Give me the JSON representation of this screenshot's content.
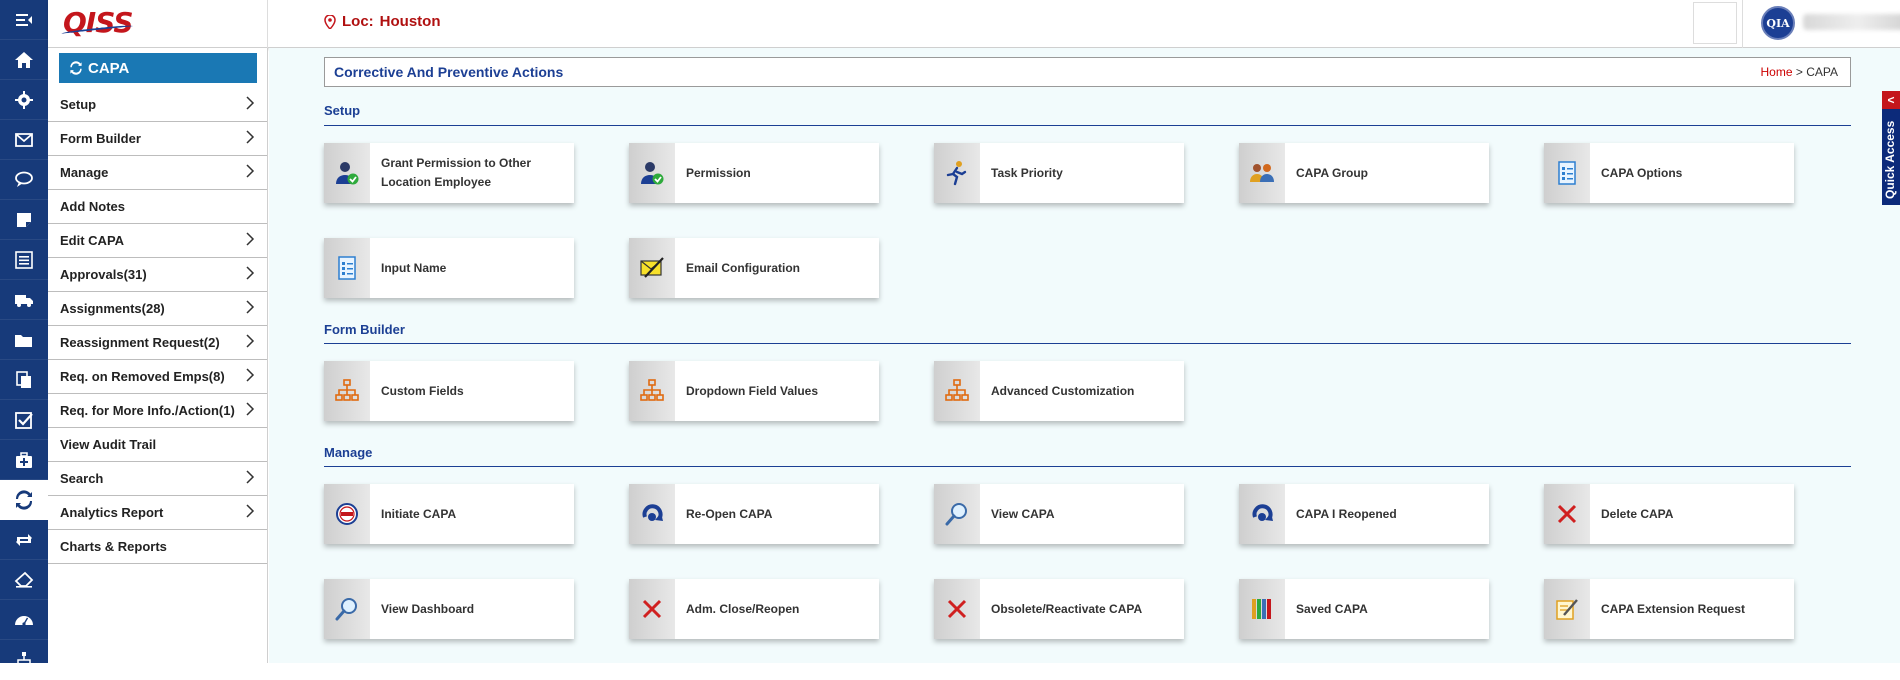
{
  "header": {
    "logo_text": "QISS",
    "location_label": "Loc:",
    "location_value": "Houston",
    "avatar_text": "QIA"
  },
  "rail": {
    "items": [
      "menu-icon",
      "home-icon",
      "gear-icon",
      "mail-icon",
      "chat-icon",
      "note-icon",
      "list-icon",
      "truck-icon",
      "folder-icon",
      "documents-icon",
      "checkbox-icon",
      "medical-kit-icon",
      "refresh-icon",
      "exchange-icon",
      "eraser-icon",
      "dashboard-icon",
      "sitemap-icon"
    ],
    "active": "refresh-icon"
  },
  "submenu": {
    "title": "CAPA",
    "items": [
      {
        "label": "Setup",
        "arrow": true
      },
      {
        "label": "Form Builder",
        "arrow": true
      },
      {
        "label": "Manage",
        "arrow": true
      },
      {
        "label": "Add Notes",
        "arrow": false
      },
      {
        "label": "Edit CAPA",
        "arrow": true
      },
      {
        "label": "Approvals(31)",
        "arrow": true
      },
      {
        "label": "Assignments(28)",
        "arrow": true
      },
      {
        "label": "Reassignment Request(2)",
        "arrow": true
      },
      {
        "label": "Req. on Removed Emps(8)",
        "arrow": true
      },
      {
        "label": "Req. for More Info./Action(1)",
        "arrow": true
      },
      {
        "label": "View Audit Trail",
        "arrow": false
      },
      {
        "label": "Search",
        "arrow": true
      },
      {
        "label": "Analytics Report",
        "arrow": true
      },
      {
        "label": "Charts & Reports",
        "arrow": false
      }
    ]
  },
  "page": {
    "title": "Corrective And Preventive Actions",
    "breadcrumb_home": "Home",
    "breadcrumb_sep": " > ",
    "breadcrumb_current": "CAPA"
  },
  "sections": {
    "setup": {
      "title": "Setup",
      "tiles": [
        {
          "label": "Grant Permission to Other Location Employee",
          "icon": "user-check-icon"
        },
        {
          "label": "Permission",
          "icon": "user-check-icon"
        },
        {
          "label": "Task Priority",
          "icon": "runner-icon"
        },
        {
          "label": "CAPA Group",
          "icon": "group-icon"
        },
        {
          "label": "CAPA Options",
          "icon": "checklist-icon"
        },
        {
          "label": "Input Name",
          "icon": "checklist-icon"
        },
        {
          "label": "Email Configuration",
          "icon": "email-config-icon"
        }
      ]
    },
    "form_builder": {
      "title": "Form Builder",
      "tiles": [
        {
          "label": "Custom Fields",
          "icon": "hierarchy-icon"
        },
        {
          "label": "Dropdown Field Values",
          "icon": "hierarchy-icon"
        },
        {
          "label": "Advanced Customization",
          "icon": "hierarchy-icon"
        }
      ]
    },
    "manage": {
      "title": "Manage",
      "tiles": [
        {
          "label": "Initiate CAPA",
          "icon": "capa-badge-icon"
        },
        {
          "label": "Re-Open CAPA",
          "icon": "reopen-icon"
        },
        {
          "label": "View CAPA",
          "icon": "magnifier-icon"
        },
        {
          "label": "CAPA I Reopened",
          "icon": "reopen-icon"
        },
        {
          "label": "Delete CAPA",
          "icon": "delete-x-icon"
        },
        {
          "label": "View Dashboard",
          "icon": "magnifier-icon"
        },
        {
          "label": "Adm. Close/Reopen",
          "icon": "delete-x-icon"
        },
        {
          "label": "Obsolete/Reactivate CAPA",
          "icon": "delete-x-icon"
        },
        {
          "label": "Saved CAPA",
          "icon": "books-icon"
        },
        {
          "label": "CAPA Extension Request",
          "icon": "edit-note-icon"
        }
      ]
    }
  },
  "quick_access": {
    "label": "Quick Access",
    "tab_symbol": "<"
  },
  "colors": {
    "rail": "#173a7a",
    "accent": "#1a78b4",
    "title_blue": "#1c3f94",
    "red": "#c4161c",
    "content_bg": "#f2fbfc"
  }
}
